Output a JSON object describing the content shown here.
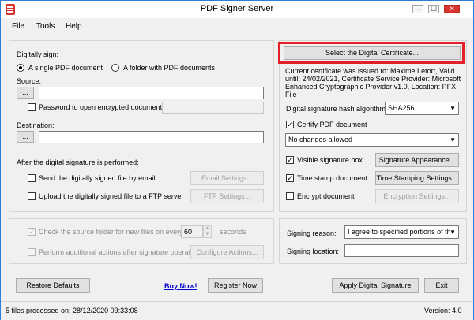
{
  "window": {
    "title": "PDF Signer Server",
    "minimize": "—",
    "maximize": "☐",
    "close": "✕"
  },
  "menu": {
    "file": "File",
    "tools": "Tools",
    "help": "Help"
  },
  "sign": {
    "heading": "Digitally sign:",
    "radio_single": "A single PDF document",
    "radio_folder": "A folder with PDF documents",
    "source_label": "Source:",
    "browse": "...",
    "source_value": "",
    "password_label": "Password to open encrypted documents:",
    "password_value": "",
    "destination_label": "Destination:",
    "destination_value": ""
  },
  "after": {
    "heading": "After the digital signature is performed:",
    "email_label": "Send the digitally signed file by email",
    "email_button": "Email Settings...",
    "ftp_label": "Upload the digitally signed file to a FTP server",
    "ftp_button": "FTP Settings..."
  },
  "monitor": {
    "check_label": "Check the source folder for new files on every",
    "interval": "60",
    "unit": "seconds",
    "additional_label": "Perform additional actions after signature operation",
    "configure_button": "Configure Actions..."
  },
  "cert": {
    "select_button": "Select the Digital Certificate...",
    "info": "Current certificate was issued to: Maxime Letort, Valid until: 24/02/2021, Certificate Service Provider: Microsoft Enhanced Cryptographic Provider v1.0, Location: PFX File",
    "hash_label": "Digital signature hash algorithm:",
    "hash_value": "SHA256",
    "certify_label": "Certify PDF document",
    "changes_value": "No changes allowed",
    "visible_label": "Visible signature box",
    "appearance_button": "Signature Appearance...",
    "timestamp_label": "Time stamp document",
    "timestamp_button": "Time Stamping Settings...",
    "encrypt_label": "Encrypt document",
    "encryption_button": "Encryption Settings..."
  },
  "signing": {
    "reason_label": "Signing reason:",
    "reason_value": "I agree to specified portions of this",
    "location_label": "Signing location:",
    "location_value": ""
  },
  "footer": {
    "restore_button": "Restore Defaults",
    "buy_link": "Buy Now!",
    "register_button": "Register Now",
    "apply_button": "Apply Digital Signature",
    "exit_button": "Exit"
  },
  "status": {
    "left": "5 files processed on: 28/12/2020 09:33:08",
    "version": "Version: 4.0"
  },
  "colors": {
    "accent": "#2b7fd6",
    "highlight": "#e2202a",
    "link": "#0000cc"
  }
}
